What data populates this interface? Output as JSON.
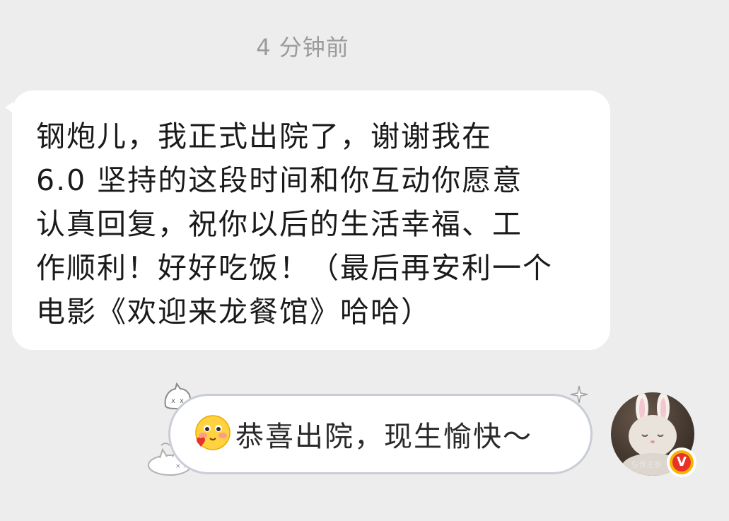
{
  "timestamp": "4 分钟前",
  "incoming_message": {
    "text": "钢炮儿，我正式出院了，谢谢我在\n6.0 坚持的这段时间和你互动你愿意\n认真回复，祝你以后的生活幸福、工\n作顺利！好好吃饭！（最后再安利一个\n电影《欢迎来龙餐馆》哈哈）"
  },
  "outgoing_message": {
    "emoji": "blush-heart-emoji",
    "text": "恭喜出院，现生愉快～"
  },
  "avatar": {
    "caption": "与世无争",
    "badge": "V",
    "badge_color": "#f5b400"
  },
  "colors": {
    "background": "#ededed",
    "bubble": "#ffffff",
    "outgoing_border": "#c9cdd6",
    "timestamp": "#9b9b9b"
  }
}
